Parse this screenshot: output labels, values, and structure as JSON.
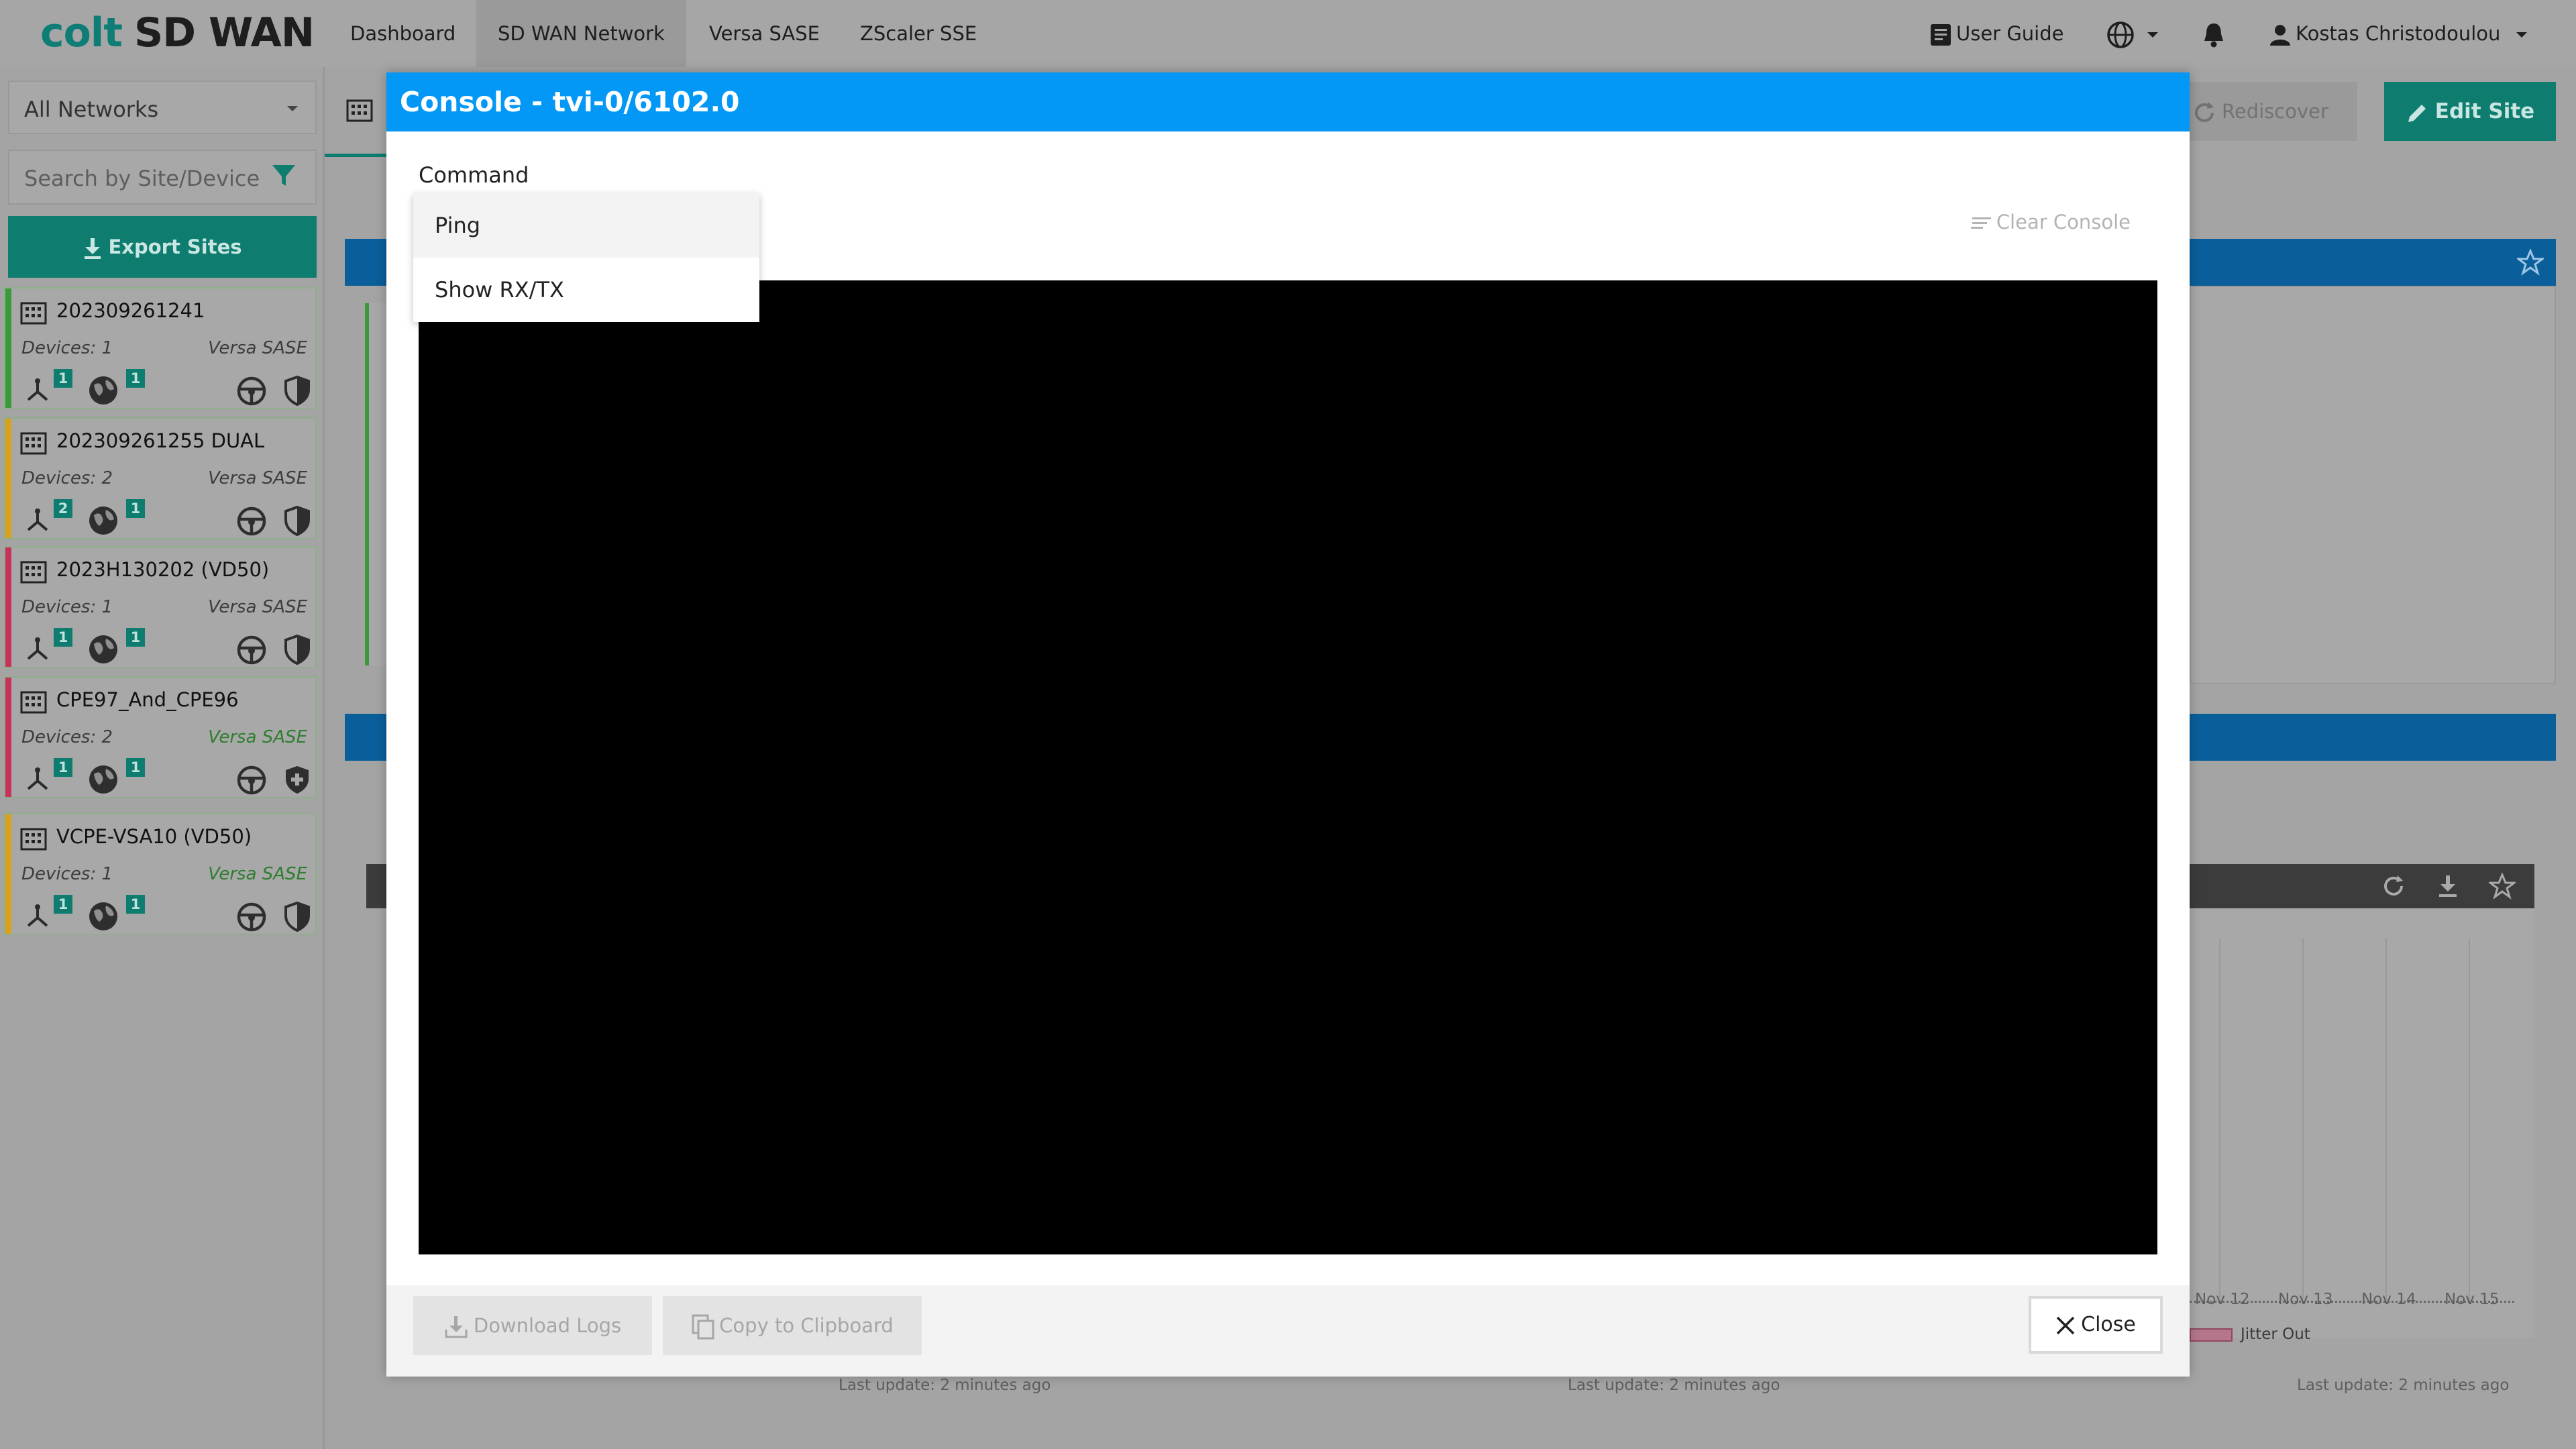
{
  "app": {
    "logo_primary": "colt",
    "logo_secondary": "SD WAN"
  },
  "nav": {
    "items": [
      {
        "label": "Dashboard"
      },
      {
        "label": "SD WAN Network"
      },
      {
        "label": "Versa SASE"
      },
      {
        "label": "ZScaler SSE"
      }
    ],
    "active": "SD WAN Network"
  },
  "topright": {
    "user_guide": "User Guide",
    "user_name": "Kostas Christodoulou"
  },
  "sidebar": {
    "network_select": "All Networks",
    "search_placeholder": "Search by Site/Device",
    "export_label": "Export Sites",
    "sites": [
      {
        "name": "202309261241",
        "devices": "Devices: 1",
        "vendor": "Versa SASE",
        "count_a": "1",
        "count_b": "1",
        "status_color": "#3a9a3a"
      },
      {
        "name": "202309261255 DUAL",
        "devices": "Devices: 2",
        "vendor": "Versa SASE",
        "count_a": "2",
        "count_b": "1",
        "status_color": "#d9a21c"
      },
      {
        "name": "2023H130202 (VD50)",
        "devices": "Devices: 1",
        "vendor": "Versa SASE",
        "count_a": "1",
        "count_b": "1",
        "status_color": "#c8325a"
      },
      {
        "name": "CPE97_And_CPE96",
        "devices": "Devices: 2",
        "vendor": "Versa SASE",
        "count_a": "1",
        "count_b": "1",
        "status_color": "#c8325a"
      },
      {
        "name": "VCPE-VSA10 (VD50)",
        "devices": "Devices: 1",
        "vendor": "Versa SASE",
        "count_a": "1",
        "count_b": "1",
        "status_color": "#d9a21c"
      }
    ]
  },
  "background": {
    "rediscover": "Rediscover",
    "edit_site": "Edit Site",
    "chart_x_ticks": [
      "Nov 12",
      "Nov 13",
      "Nov 14",
      "Nov 15"
    ],
    "legend_jitter_out": "Jitter Out",
    "last_update": "Last update: 2 minutes ago"
  },
  "modal": {
    "title": "Console - tvi-0/6102.0",
    "command_label": "Command",
    "clear_console": "Clear Console",
    "dropdown_options": [
      "Ping",
      "Show RX/TX"
    ],
    "download_logs": "Download Logs",
    "copy_clipboard": "Copy to Clipboard",
    "close": "Close"
  },
  "colors": {
    "header_blue": "#0398f5",
    "brand_teal": "#0e7d70",
    "console_bg": "#000000"
  }
}
